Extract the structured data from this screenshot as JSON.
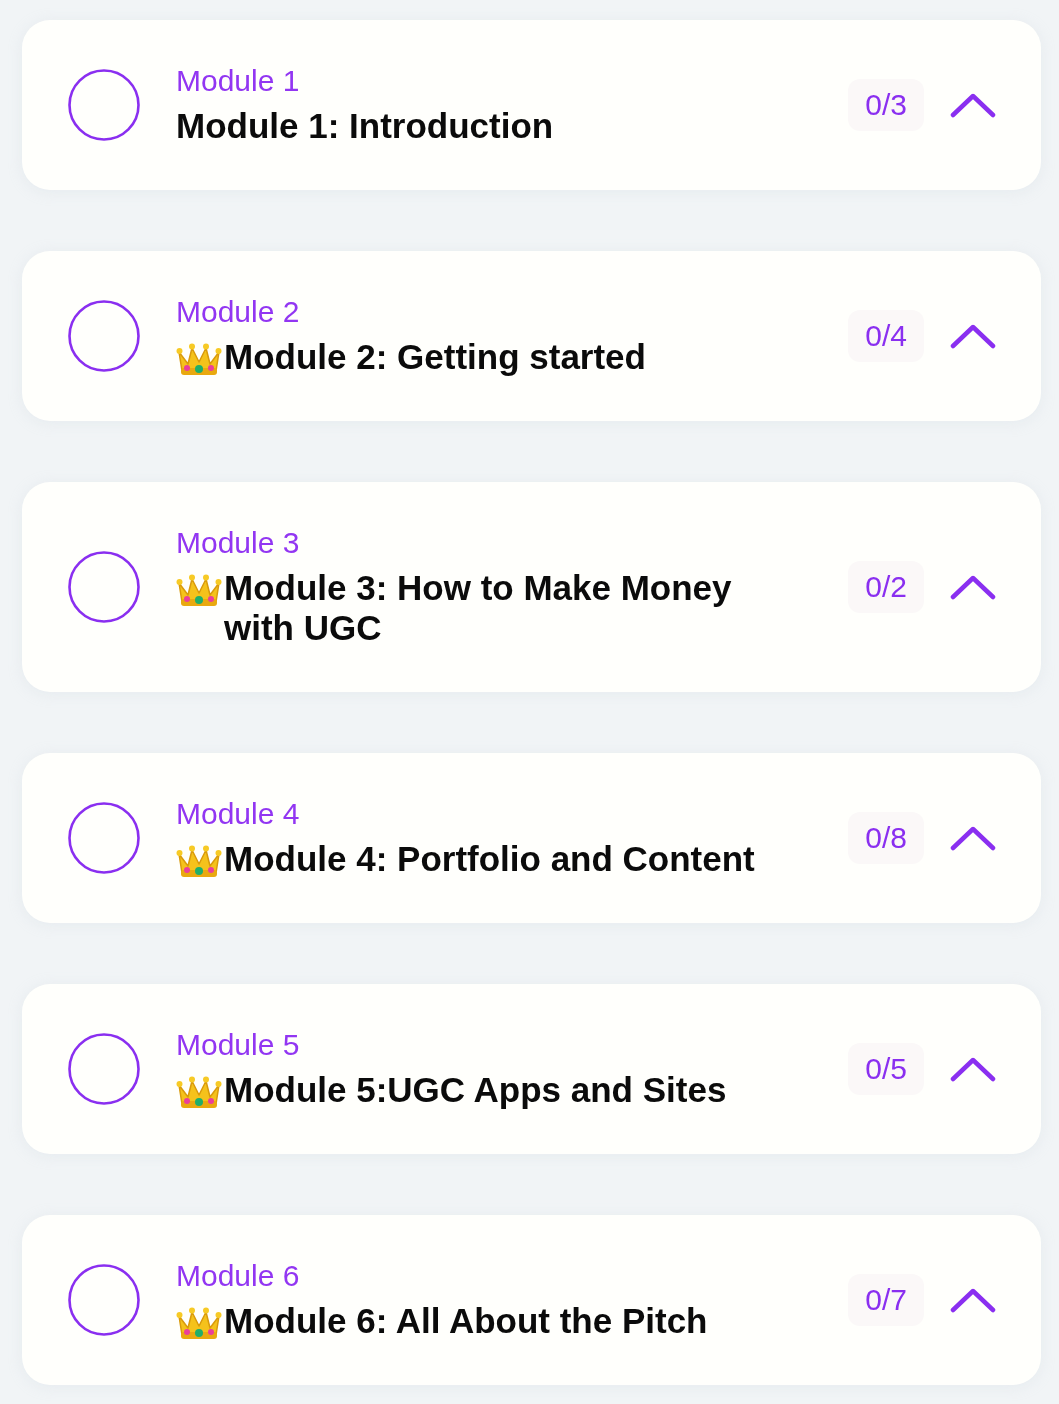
{
  "modules": [
    {
      "label": "Module 1",
      "title_icon": false,
      "title": "Module 1: Introduction",
      "progress": "0/3",
      "completed": false
    },
    {
      "label": "Module 2",
      "title_icon": true,
      "title": "Module 2: Getting started",
      "progress": "0/4",
      "completed": false
    },
    {
      "label": "Module 3",
      "title_icon": true,
      "title": "Module 3: How to Make Money with UGC",
      "progress": "0/2",
      "completed": false
    },
    {
      "label": "Module 4",
      "title_icon": true,
      "title": "Module 4: Portfolio and Content",
      "progress": "0/8",
      "completed": false
    },
    {
      "label": "Module 5",
      "title_icon": true,
      "title": "Module 5:UGC Apps and Sites",
      "progress": "0/5",
      "completed": false
    },
    {
      "label": "Module 6",
      "title_icon": true,
      "title": "Module 6: All About the Pitch",
      "progress": "0/7",
      "completed": false
    }
  ]
}
